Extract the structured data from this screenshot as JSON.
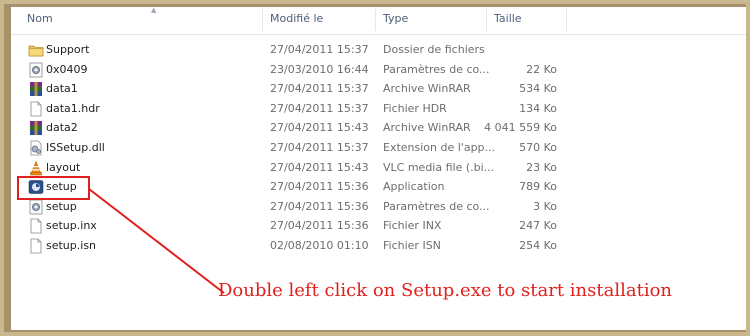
{
  "columns": {
    "name": "Nom",
    "modified": "Modifié le",
    "type": "Type",
    "size": "Taille"
  },
  "files": [
    {
      "name": "Support",
      "modified": "27/04/2011 15:37",
      "type": "Dossier de fichiers",
      "size": "",
      "icon": "folder-icon"
    },
    {
      "name": "0x0409",
      "modified": "23/03/2010 16:44",
      "type": "Paramètres de co...",
      "size": "22 Ko",
      "icon": "settings-file-icon"
    },
    {
      "name": "data1",
      "modified": "27/04/2011 15:37",
      "type": "Archive WinRAR",
      "size": "534 Ko",
      "icon": "winrar-icon"
    },
    {
      "name": "data1.hdr",
      "modified": "27/04/2011 15:37",
      "type": "Fichier HDR",
      "size": "134 Ko",
      "icon": "file-icon"
    },
    {
      "name": "data2",
      "modified": "27/04/2011 15:43",
      "type": "Archive WinRAR",
      "size": "4 041 559 Ko",
      "icon": "winrar-icon"
    },
    {
      "name": "ISSetup.dll",
      "modified": "27/04/2011 15:37",
      "type": "Extension de l'app...",
      "size": "570 Ko",
      "icon": "dll-icon"
    },
    {
      "name": "layout",
      "modified": "27/04/2011 15:43",
      "type": "VLC media file (.bi...",
      "size": "23 Ko",
      "icon": "vlc-icon"
    },
    {
      "name": "setup",
      "modified": "27/04/2011 15:36",
      "type": "Application",
      "size": "789 Ko",
      "icon": "setup-app-icon"
    },
    {
      "name": "setup",
      "modified": "27/04/2011 15:36",
      "type": "Paramètres de co...",
      "size": "3 Ko",
      "icon": "settings-file-icon"
    },
    {
      "name": "setup.inx",
      "modified": "27/04/2011 15:36",
      "type": "Fichier INX",
      "size": "247 Ko",
      "icon": "file-icon"
    },
    {
      "name": "setup.isn",
      "modified": "02/08/2010 01:10",
      "type": "Fichier ISN",
      "size": "254 Ko",
      "icon": "file-icon"
    }
  ],
  "annotation": {
    "text": "Double left click on Setup.exe to start installation",
    "color": "#e0201c"
  }
}
